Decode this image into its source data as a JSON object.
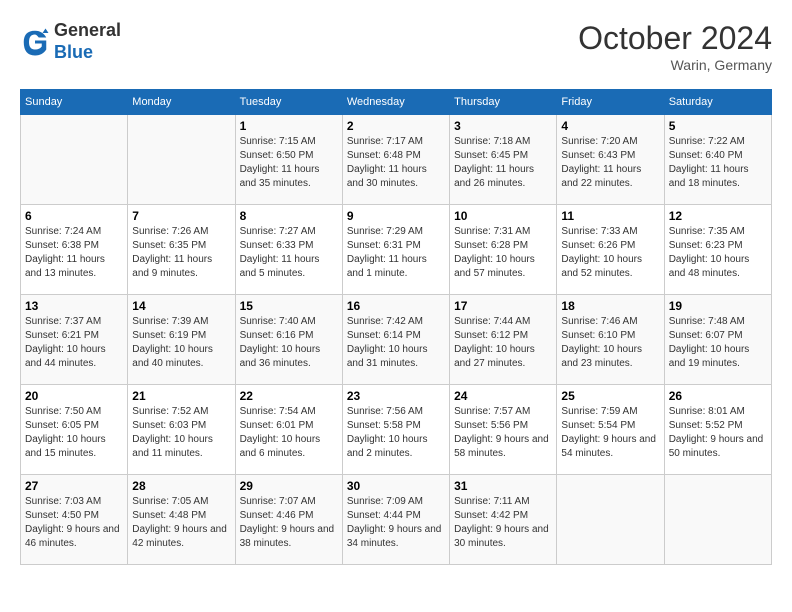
{
  "header": {
    "logo_line1": "General",
    "logo_line2": "Blue",
    "month_title": "October 2024",
    "location": "Warin, Germany"
  },
  "weekdays": [
    "Sunday",
    "Monday",
    "Tuesday",
    "Wednesday",
    "Thursday",
    "Friday",
    "Saturday"
  ],
  "weeks": [
    [
      {
        "day": "",
        "sunrise": "",
        "sunset": "",
        "daylight": ""
      },
      {
        "day": "",
        "sunrise": "",
        "sunset": "",
        "daylight": ""
      },
      {
        "day": "1",
        "sunrise": "Sunrise: 7:15 AM",
        "sunset": "Sunset: 6:50 PM",
        "daylight": "Daylight: 11 hours and 35 minutes."
      },
      {
        "day": "2",
        "sunrise": "Sunrise: 7:17 AM",
        "sunset": "Sunset: 6:48 PM",
        "daylight": "Daylight: 11 hours and 30 minutes."
      },
      {
        "day": "3",
        "sunrise": "Sunrise: 7:18 AM",
        "sunset": "Sunset: 6:45 PM",
        "daylight": "Daylight: 11 hours and 26 minutes."
      },
      {
        "day": "4",
        "sunrise": "Sunrise: 7:20 AM",
        "sunset": "Sunset: 6:43 PM",
        "daylight": "Daylight: 11 hours and 22 minutes."
      },
      {
        "day": "5",
        "sunrise": "Sunrise: 7:22 AM",
        "sunset": "Sunset: 6:40 PM",
        "daylight": "Daylight: 11 hours and 18 minutes."
      }
    ],
    [
      {
        "day": "6",
        "sunrise": "Sunrise: 7:24 AM",
        "sunset": "Sunset: 6:38 PM",
        "daylight": "Daylight: 11 hours and 13 minutes."
      },
      {
        "day": "7",
        "sunrise": "Sunrise: 7:26 AM",
        "sunset": "Sunset: 6:35 PM",
        "daylight": "Daylight: 11 hours and 9 minutes."
      },
      {
        "day": "8",
        "sunrise": "Sunrise: 7:27 AM",
        "sunset": "Sunset: 6:33 PM",
        "daylight": "Daylight: 11 hours and 5 minutes."
      },
      {
        "day": "9",
        "sunrise": "Sunrise: 7:29 AM",
        "sunset": "Sunset: 6:31 PM",
        "daylight": "Daylight: 11 hours and 1 minute."
      },
      {
        "day": "10",
        "sunrise": "Sunrise: 7:31 AM",
        "sunset": "Sunset: 6:28 PM",
        "daylight": "Daylight: 10 hours and 57 minutes."
      },
      {
        "day": "11",
        "sunrise": "Sunrise: 7:33 AM",
        "sunset": "Sunset: 6:26 PM",
        "daylight": "Daylight: 10 hours and 52 minutes."
      },
      {
        "day": "12",
        "sunrise": "Sunrise: 7:35 AM",
        "sunset": "Sunset: 6:23 PM",
        "daylight": "Daylight: 10 hours and 48 minutes."
      }
    ],
    [
      {
        "day": "13",
        "sunrise": "Sunrise: 7:37 AM",
        "sunset": "Sunset: 6:21 PM",
        "daylight": "Daylight: 10 hours and 44 minutes."
      },
      {
        "day": "14",
        "sunrise": "Sunrise: 7:39 AM",
        "sunset": "Sunset: 6:19 PM",
        "daylight": "Daylight: 10 hours and 40 minutes."
      },
      {
        "day": "15",
        "sunrise": "Sunrise: 7:40 AM",
        "sunset": "Sunset: 6:16 PM",
        "daylight": "Daylight: 10 hours and 36 minutes."
      },
      {
        "day": "16",
        "sunrise": "Sunrise: 7:42 AM",
        "sunset": "Sunset: 6:14 PM",
        "daylight": "Daylight: 10 hours and 31 minutes."
      },
      {
        "day": "17",
        "sunrise": "Sunrise: 7:44 AM",
        "sunset": "Sunset: 6:12 PM",
        "daylight": "Daylight: 10 hours and 27 minutes."
      },
      {
        "day": "18",
        "sunrise": "Sunrise: 7:46 AM",
        "sunset": "Sunset: 6:10 PM",
        "daylight": "Daylight: 10 hours and 23 minutes."
      },
      {
        "day": "19",
        "sunrise": "Sunrise: 7:48 AM",
        "sunset": "Sunset: 6:07 PM",
        "daylight": "Daylight: 10 hours and 19 minutes."
      }
    ],
    [
      {
        "day": "20",
        "sunrise": "Sunrise: 7:50 AM",
        "sunset": "Sunset: 6:05 PM",
        "daylight": "Daylight: 10 hours and 15 minutes."
      },
      {
        "day": "21",
        "sunrise": "Sunrise: 7:52 AM",
        "sunset": "Sunset: 6:03 PM",
        "daylight": "Daylight: 10 hours and 11 minutes."
      },
      {
        "day": "22",
        "sunrise": "Sunrise: 7:54 AM",
        "sunset": "Sunset: 6:01 PM",
        "daylight": "Daylight: 10 hours and 6 minutes."
      },
      {
        "day": "23",
        "sunrise": "Sunrise: 7:56 AM",
        "sunset": "Sunset: 5:58 PM",
        "daylight": "Daylight: 10 hours and 2 minutes."
      },
      {
        "day": "24",
        "sunrise": "Sunrise: 7:57 AM",
        "sunset": "Sunset: 5:56 PM",
        "daylight": "Daylight: 9 hours and 58 minutes."
      },
      {
        "day": "25",
        "sunrise": "Sunrise: 7:59 AM",
        "sunset": "Sunset: 5:54 PM",
        "daylight": "Daylight: 9 hours and 54 minutes."
      },
      {
        "day": "26",
        "sunrise": "Sunrise: 8:01 AM",
        "sunset": "Sunset: 5:52 PM",
        "daylight": "Daylight: 9 hours and 50 minutes."
      }
    ],
    [
      {
        "day": "27",
        "sunrise": "Sunrise: 7:03 AM",
        "sunset": "Sunset: 4:50 PM",
        "daylight": "Daylight: 9 hours and 46 minutes."
      },
      {
        "day": "28",
        "sunrise": "Sunrise: 7:05 AM",
        "sunset": "Sunset: 4:48 PM",
        "daylight": "Daylight: 9 hours and 42 minutes."
      },
      {
        "day": "29",
        "sunrise": "Sunrise: 7:07 AM",
        "sunset": "Sunset: 4:46 PM",
        "daylight": "Daylight: 9 hours and 38 minutes."
      },
      {
        "day": "30",
        "sunrise": "Sunrise: 7:09 AM",
        "sunset": "Sunset: 4:44 PM",
        "daylight": "Daylight: 9 hours and 34 minutes."
      },
      {
        "day": "31",
        "sunrise": "Sunrise: 7:11 AM",
        "sunset": "Sunset: 4:42 PM",
        "daylight": "Daylight: 9 hours and 30 minutes."
      },
      {
        "day": "",
        "sunrise": "",
        "sunset": "",
        "daylight": ""
      },
      {
        "day": "",
        "sunrise": "",
        "sunset": "",
        "daylight": ""
      }
    ]
  ]
}
